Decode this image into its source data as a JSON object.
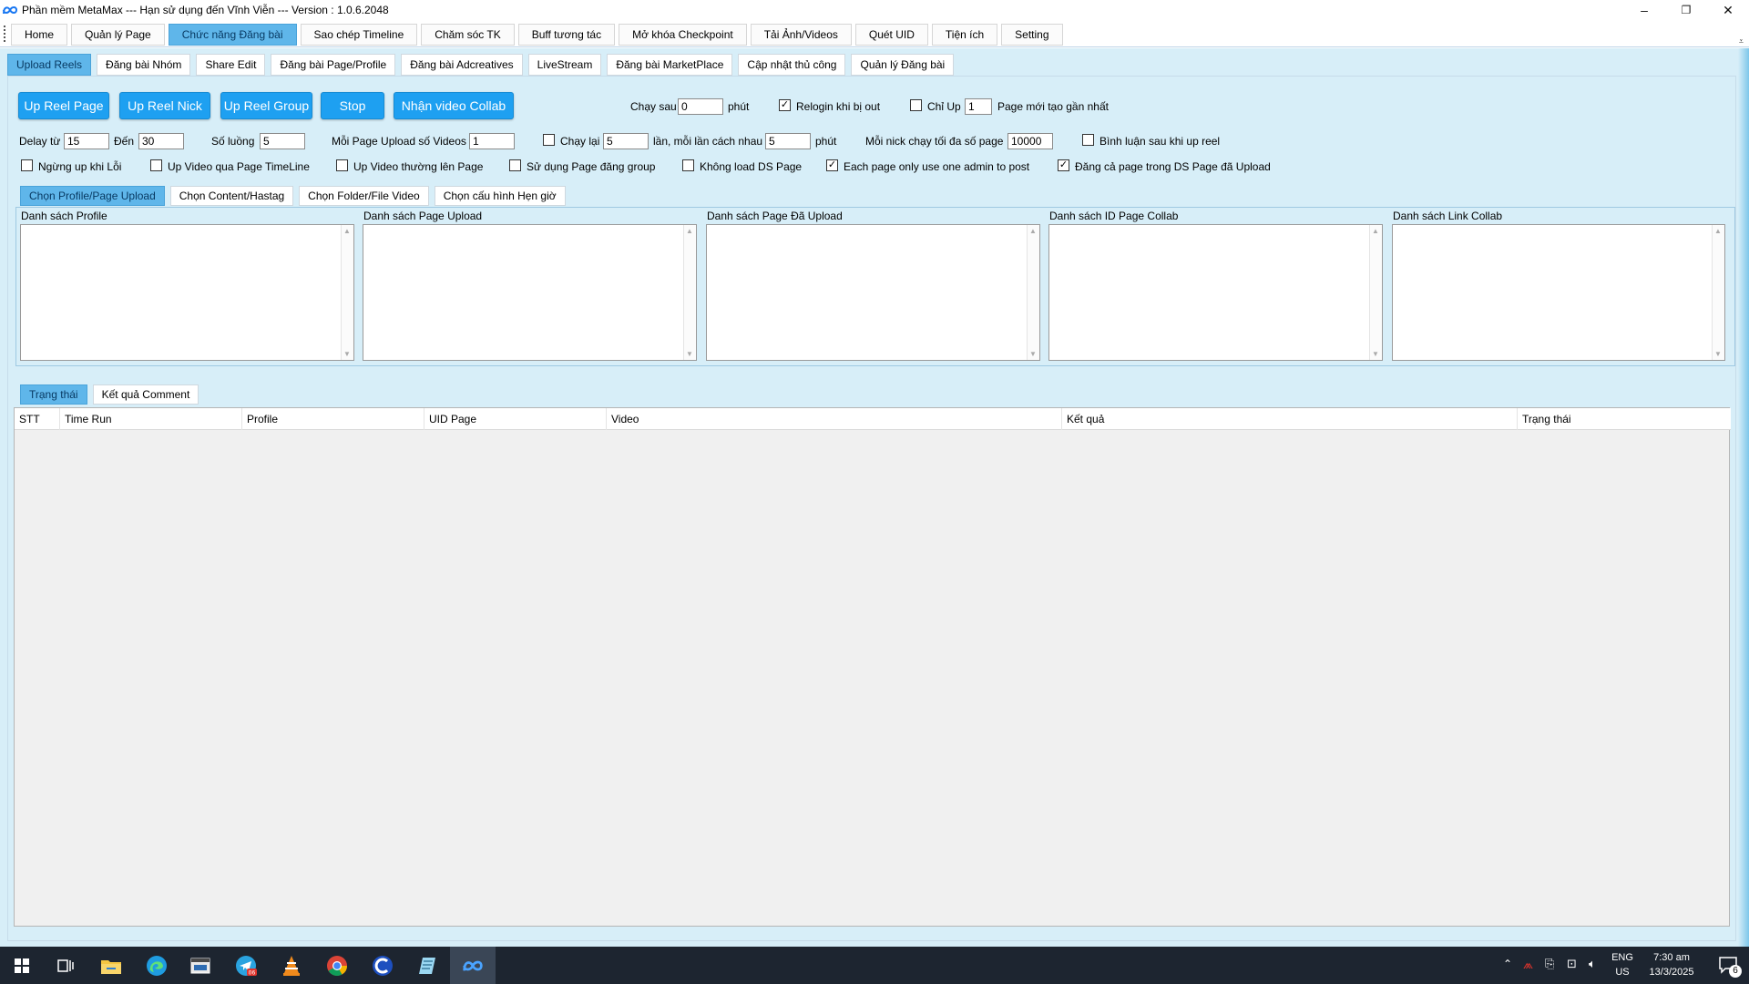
{
  "window": {
    "title": "Phần mềm MetaMax --- Hạn sử dụng đến Vĩnh Viễn --- Version : 1.0.6.2048",
    "minimize": "–",
    "maximize": "❐",
    "close": "✕"
  },
  "menu": {
    "tabs": [
      {
        "label": "Home"
      },
      {
        "label": "Quản lý Page"
      },
      {
        "label": "Chức năng Đăng bài"
      },
      {
        "label": "Sao chép Timeline"
      },
      {
        "label": "Chăm sóc TK"
      },
      {
        "label": "Buff tương tác"
      },
      {
        "label": "Mở khóa Checkpoint"
      },
      {
        "label": "Tải Ảnh/Videos"
      },
      {
        "label": "Quét UID"
      },
      {
        "label": "Tiện ích"
      },
      {
        "label": "Setting"
      }
    ],
    "active_index": 2
  },
  "subtabs": [
    {
      "label": "Upload Reels"
    },
    {
      "label": "Đăng bài Nhóm"
    },
    {
      "label": "Share Edit"
    },
    {
      "label": "Đăng bài Page/Profile"
    },
    {
      "label": "Đăng bài Adcreatives"
    },
    {
      "label": "LiveStream"
    },
    {
      "label": "Đăng bài MarketPlace"
    },
    {
      "label": "Cập nhật thủ công"
    },
    {
      "label": "Quản lý Đăng bài"
    }
  ],
  "buttons": {
    "up_reel_page": "Up Reel Page",
    "up_reel_nick": "Up Reel Nick",
    "up_reel_group": "Up Reel Group",
    "stop": "Stop",
    "nhan_video_collab": "Nhận video Collab"
  },
  "options": {
    "chay_sau_label": "Chạy sau",
    "chay_sau_value": "0",
    "phut1": "phút",
    "relogin_label": "Relogin khi bị out",
    "relogin_checked": "✓",
    "chi_up_label": "Chỉ Up",
    "chi_up_value": "1",
    "page_moi_label": "Page mới tạo gần nhất",
    "delay_tu_label": "Delay từ",
    "delay_tu_value": "15",
    "den_label": "Đến",
    "den_value": "30",
    "so_luong_label": "Số luồng",
    "so_luong_value": "5",
    "moi_page_label": "Mỗi Page Upload số Videos",
    "moi_page_value": "1",
    "chay_lai_label": "Chạy lại",
    "chay_lai_value": "5",
    "lan_label": "lần, mỗi lần cách nhau",
    "cach_value": "5",
    "phut2": "phút",
    "moi_nick_label": "Mỗi nick chạy tối đa số page",
    "moi_nick_value": "10000",
    "binh_luan_label": "Bình luận sau khi up reel",
    "ngung_up_label": "Ngừng up khi Lỗi",
    "up_timeline_label": "Up Video qua Page TimeLine",
    "up_thuong_label": "Up Video thường lên Page",
    "su_dung_group_label": "Sử dụng Page đăng group",
    "khong_load_label": "Không load DS Page",
    "each_page_label": "Each page only use one admin to post",
    "each_page_checked": "✓",
    "dang_ca_label": "Đăng cả page trong DS Page đã Upload",
    "dang_ca_checked": "✓"
  },
  "inner_tabs": [
    {
      "label": "Chọn Profile/Page Upload"
    },
    {
      "label": "Chọn Content/Hastag"
    },
    {
      "label": "Chọn Folder/File Video"
    },
    {
      "label": "Chọn cấu hình Hẹn giờ"
    }
  ],
  "lists": [
    {
      "caption": "Danh sách Profile"
    },
    {
      "caption": "Danh sách Page Upload"
    },
    {
      "caption": "Danh sách Page Đã Upload"
    },
    {
      "caption": "Danh sách ID Page Collab"
    },
    {
      "caption": "Danh sách Link Collab"
    }
  ],
  "bottom_tabs": [
    {
      "label": "Trạng thái"
    },
    {
      "label": "Kết quả Comment"
    }
  ],
  "table": {
    "columns": [
      "STT",
      "Time Run",
      "Profile",
      "UID Page",
      "Video",
      "Kết quả",
      "Trạng thái"
    ]
  },
  "taskbar": {
    "lang_line1": "ENG",
    "lang_line2": "US",
    "time": "7:30 am",
    "date": "13/3/2025",
    "notif_count": "6",
    "telegram_badge": "06"
  }
}
